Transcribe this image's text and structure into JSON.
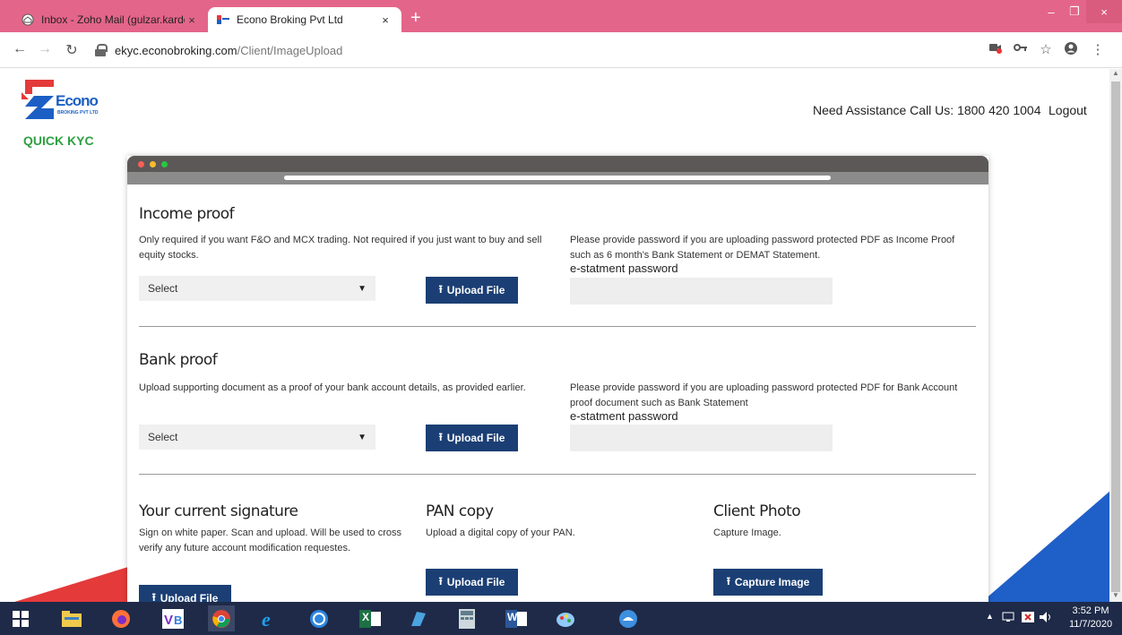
{
  "browser": {
    "tabs": [
      {
        "title": "Inbox - Zoho Mail (gulzar.kardon",
        "close": "×"
      },
      {
        "title": "Econo Broking Pvt Ltd",
        "close": "×"
      }
    ],
    "new_tab": "+",
    "window_controls": {
      "minimize": "–",
      "maximize": "❐",
      "close": "×"
    },
    "url_host": "ekyc.econobroking.com",
    "url_path": "/Client/ImageUpload"
  },
  "header": {
    "logo_text": "Econo",
    "logo_sub": "BROKING PVT LTD",
    "quick_kyc": "QUICK KYC",
    "assistance": "Need Assistance Call Us: 1800 420 1004",
    "logout": "Logout"
  },
  "income": {
    "title": "Income proof",
    "description": "Only required if you want F&O and MCX trading. Not required if you just want to buy and sell equity stocks.",
    "select_value": "Select",
    "upload_label": "Upload File",
    "password_note": "Please provide password if you are uploading password protected PDF as Income Proof such as 6 month's Bank Statement or DEMAT Statement.",
    "password_label": "e-statment password"
  },
  "bank": {
    "title": "Bank proof",
    "description": "Upload supporting document as a proof of your bank account details, as provided earlier.",
    "select_value": "Select",
    "upload_label": "Upload File",
    "password_note": "Please provide password if you are uploading password protected PDF for Bank Account proof document such as Bank Statement",
    "password_label": "e-statment password"
  },
  "signature": {
    "title": "Your current signature",
    "description": "Sign on white paper. Scan and upload. Will be used to cross verify any future account modification requestes.",
    "upload_label": "Upload File"
  },
  "pan": {
    "title": "PAN copy",
    "description": "Upload a digital copy of your PAN.",
    "upload_label": "Upload File"
  },
  "photo": {
    "title": "Client Photo",
    "description": "Capture Image.",
    "capture_label": "Capture Image"
  },
  "taskbar": {
    "excel_label": "X",
    "word_label": "W",
    "time": "3:52 PM",
    "date": "11/7/2020"
  },
  "colors": {
    "chrome_tabstrip": "#e4658a",
    "button_blue": "#1b3f74",
    "brand_blue": "#1b5fc4",
    "brand_red": "#e43a3a",
    "kyc_green": "#2ea043",
    "taskbar": "#1e2a48"
  }
}
